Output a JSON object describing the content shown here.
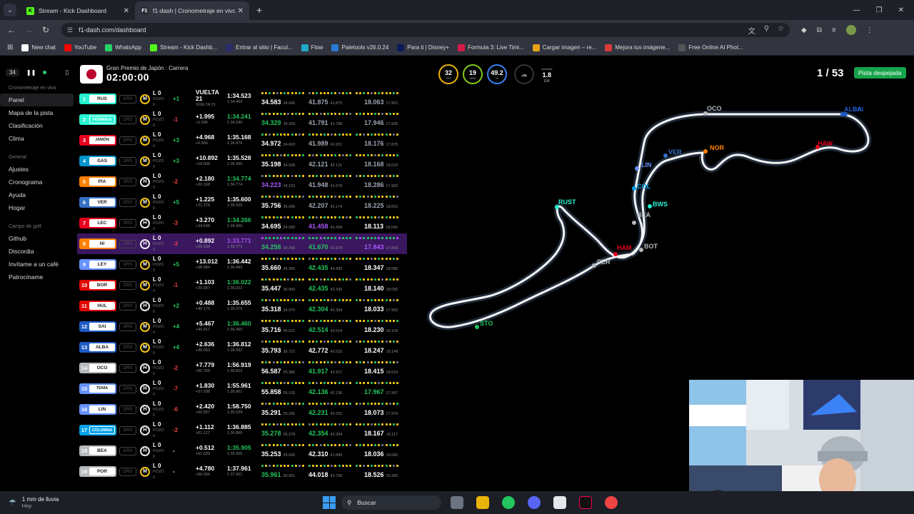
{
  "browser": {
    "tabs": [
      {
        "title": "Stream - Kick Dashboard",
        "fav": "K",
        "fav_color": "#53fc18",
        "active": false
      },
      {
        "title": "f1-dash | Cronometraje en vivo",
        "fav": "F1",
        "fav_color": "#e10600",
        "active": true
      }
    ],
    "url": "f1-dash.com/dashboard",
    "bookmarks": [
      {
        "label": "New chat",
        "color": "#ffffff"
      },
      {
        "label": "YouTube",
        "color": "#ff0000"
      },
      {
        "label": "WhatsApp",
        "color": "#25d366"
      },
      {
        "label": "Stream - Kick Dashb...",
        "color": "#53fc18"
      },
      {
        "label": "Entrar al sitio | Facul...",
        "color": "#2b2b6b"
      },
      {
        "label": "Flow",
        "color": "#22aacc"
      },
      {
        "label": "Paletools v26.0.24",
        "color": "#2a7ad4"
      },
      {
        "label": "Para ti | Disney+",
        "color": "#0a1a5a"
      },
      {
        "label": "Formula 3: Live Timi...",
        "color": "#d51a4a"
      },
      {
        "label": "Cargar imagen – re...",
        "color": "#e8a21a"
      },
      {
        "label": "Mejora tus imágene...",
        "color": "#d93a3a"
      },
      {
        "label": "Free Online AI Phot...",
        "color": "#555555"
      }
    ]
  },
  "sidebar": {
    "delay_badge": "34",
    "sections": [
      {
        "title": "Cronometraje en vivo",
        "items": [
          "Panel",
          "Mapa de la pista",
          "Clasificación",
          "Clima"
        ]
      },
      {
        "title": "General",
        "items": [
          "Ajustes",
          "Cronograma",
          "Ayuda",
          "Hogar"
        ]
      },
      {
        "title": "Campo de golf",
        "items": [
          "Github",
          "Discordia",
          "Invítame a un café",
          "Patrocíname"
        ]
      }
    ]
  },
  "header": {
    "race_name": "Gran Premio de Japón : Carrera",
    "race_clock": "02:00:00",
    "weather": [
      {
        "value": "32",
        "label": "TRC",
        "color": "#eab308"
      },
      {
        "value": "19",
        "label": "AIRE",
        "color": "#84cc16"
      },
      {
        "value": "49.2",
        "label": "%",
        "color": "#3b82f6"
      }
    ],
    "wind_value": "1.8",
    "wind_unit": "EM",
    "wind_dir": "noroeste",
    "lap": "1 / 53",
    "track_status": "Pista despejada",
    "track_status_color": "#16a34a"
  },
  "timing_rows": [
    {
      "pos": "1",
      "code": "RUS",
      "team": "#27f4d2",
      "tyre": "M",
      "gain": "+1",
      "gainc": "green",
      "gap": "VUELTA 21",
      "gapsub": "VUELTA 21",
      "lt": "1:34.523",
      "ltsub": "1:34.469",
      "ltc": "",
      "s1": "34.583",
      "s1s": "34.436",
      "s1c": "",
      "s2": "41.875",
      "s2s": "41.875",
      "s2c": "muted",
      "s3": "18.063",
      "s3s": "17.901",
      "s3c": "muted",
      "hl": false
    },
    {
      "pos": "2",
      "code": "HORMIGA",
      "team": "#27f4d2",
      "tyre": "M",
      "gain": "-1",
      "gainc": "red",
      "gap": "+1.995",
      "gapsub": "+1.995",
      "lt": "1:34.241",
      "ltsub": "1:34.095",
      "ltc": "green",
      "s1": "34.329",
      "s1s": "34.329",
      "s1c": "green",
      "s2": "41.791",
      "s2s": "41.758",
      "s2c": "muted",
      "s3": "17.946",
      "s3s": "17.836",
      "s3c": "muted",
      "hl": false
    },
    {
      "pos": "3",
      "code": "JAMÓN",
      "team": "#e80020",
      "tyre": "M",
      "gain": "+3",
      "gainc": "green",
      "gap": "+4.968",
      "gapsub": "+6.966",
      "lt": "1:35.168",
      "ltsub": "1:34.876",
      "ltc": "",
      "s1": "34.972",
      "s1s": "34.663",
      "s1c": "",
      "s2": "41.989",
      "s2s": "41.921",
      "s2c": "muted",
      "s3": "18.176",
      "s3s": "17.875",
      "s3c": "muted",
      "hl": false
    },
    {
      "pos": "4",
      "code": "GAS",
      "team": "#0093cc",
      "tyre": "M",
      "gain": "+3",
      "gainc": "green",
      "gap": "+10.892",
      "gapsub": "+18.008",
      "lt": "1:35.528",
      "ltsub": "1:35.436",
      "ltc": "",
      "s1": "35.198",
      "s1s": "34.939",
      "s1c": "",
      "s2": "42.121",
      "s2s": "42.121",
      "s2c": "muted",
      "s3": "18.168",
      "s3s": "18.023",
      "s3c": "muted",
      "hl": false
    },
    {
      "pos": "5",
      "code": "PIA",
      "team": "#ff8000",
      "tyre": "H",
      "gain": "-2",
      "gainc": "red",
      "gap": "+2.180",
      "gapsub": "+20.168",
      "lt": "1:34.774",
      "ltsub": "1:34.774",
      "ltc": "green",
      "s1": "34.223",
      "s1s": "34.223",
      "s1c": "purple",
      "s2": "41.948",
      "s2s": "41.678",
      "s2c": "muted",
      "s3": "18.286",
      "s3s": "17.982",
      "s3c": "muted",
      "hl": false
    },
    {
      "pos": "6",
      "code": "VER",
      "team": "#3671c6",
      "tyre": "M",
      "gain": "+5",
      "gainc": "green",
      "gap": "+1.225",
      "gapsub": "+21.378",
      "lt": "1:35.600",
      "ltsub": "1:35.535",
      "ltc": "",
      "s1": "35.756",
      "s1s": "35.066",
      "s1c": "",
      "s2": "42.207",
      "s2s": "42.174",
      "s2c": "muted",
      "s3": "18.225",
      "s3s": "18.001",
      "s3c": "muted",
      "hl": false
    },
    {
      "pos": "7",
      "code": "LEC",
      "team": "#e80020",
      "tyre": "H",
      "gain": "-3",
      "gainc": "red",
      "gap": "+3.270",
      "gapsub": "+24.648",
      "lt": "1:34.266",
      "ltsub": "1:34.266",
      "ltc": "green",
      "s1": "34.695",
      "s1s": "34.580",
      "s1c": "",
      "s2": "41.458",
      "s2s": "41.458",
      "s2c": "purple",
      "s3": "18.113",
      "s3s": "18.043",
      "s3c": "",
      "hl": false
    },
    {
      "pos": "8",
      "code": "NI",
      "team": "#ff8000",
      "tyre": "H",
      "gain": "-3",
      "gainc": "red",
      "gap": "+0.892",
      "gapsub": "+25.538",
      "lt": "1:33.771",
      "ltsub": "1:33.771",
      "ltc": "purple",
      "s1": "34.258",
      "s1s": "34.258",
      "s1c": "green",
      "s2": "41.670",
      "s2s": "41.670",
      "s2c": "green",
      "s3": "17.843",
      "s3s": "17.843",
      "s3c": "purple",
      "hl": true
    },
    {
      "pos": "9",
      "code": "LEY",
      "team": "#6692ff",
      "tyre": "M",
      "gain": "+5",
      "gainc": "green",
      "gap": "+13.012",
      "gapsub": "+38.584",
      "lt": "1:36.442",
      "ltsub": "1:36.442",
      "ltc": "",
      "s1": "35.660",
      "s1s": "35.306",
      "s1c": "",
      "s2": "42.435",
      "s2s": "42.435",
      "s2c": "green",
      "s3": "18.347",
      "s3s": "18.080",
      "s3c": "",
      "hl": false
    },
    {
      "pos": "10",
      "code": "BOR",
      "team": "#e10600",
      "tyre": "M",
      "gain": "-1",
      "gainc": "red",
      "gap": "+1.103",
      "gapsub": "+39.687",
      "lt": "1:36.022",
      "ltsub": "1:36.022",
      "ltc": "green",
      "s1": "35.447",
      "s1s": "35.083",
      "s1c": "",
      "s2": "42.435",
      "s2s": "42.435",
      "s2c": "green",
      "s3": "18.140",
      "s3s": "18.030",
      "s3c": "",
      "hl": false
    },
    {
      "pos": "11",
      "code": "HUL",
      "team": "#e10600",
      "tyre": "H",
      "gain": "+2",
      "gainc": "green",
      "gap": "+0.488",
      "gapsub": "+40.175",
      "lt": "1:35.655",
      "ltsub": "1:35.575",
      "ltc": "",
      "s1": "35.318",
      "s1s": "34.972",
      "s1c": "",
      "s2": "42.304",
      "s2s": "42.304",
      "s2c": "green",
      "s3": "18.033",
      "s3s": "17.962",
      "s3c": "",
      "hl": false
    },
    {
      "pos": "12",
      "code": "SAI",
      "team": "#1e5bc6",
      "tyre": "M",
      "gain": "+4",
      "gainc": "green",
      "gap": "+5.467",
      "gapsub": "+45.417",
      "lt": "1:36.460",
      "ltsub": "1:36.460",
      "ltc": "green",
      "s1": "35.716",
      "s1s": "35.621",
      "s1c": "",
      "s2": "42.514",
      "s2s": "42.514",
      "s2c": "green",
      "s3": "18.230",
      "s3s": "18.109",
      "s3c": "",
      "hl": false
    },
    {
      "pos": "13",
      "code": "ALBA",
      "team": "#1e5bc6",
      "tyre": "M",
      "gain": "+4",
      "gainc": "green",
      "gap": "+2.636",
      "gapsub": "+48.053",
      "lt": "1:36.812",
      "ltsub": "1:36.592",
      "ltc": "",
      "s1": "35.793",
      "s1s": "35.721",
      "s1c": "",
      "s2": "42.772",
      "s2s": "42.515",
      "s2c": "",
      "s3": "18.247",
      "s3s": "18.149",
      "s3c": "",
      "hl": false
    },
    {
      "pos": "14",
      "code": "OCO",
      "team": "#b6babd",
      "tyre": "H",
      "gain": "-2",
      "gainc": "red",
      "gap": "+7.779",
      "gapsub": "+55.768",
      "lt": "1:56.919",
      "ltsub": "1:36.822",
      "ltc": "",
      "s1": "56.587",
      "s1s": "35.386",
      "s1c": "",
      "s2": "41.917",
      "s2s": "41.917",
      "s2c": "green",
      "s3": "18.415",
      "s3s": "18.019",
      "s3c": "",
      "hl": false
    },
    {
      "pos": "15",
      "code": "TENÍA",
      "team": "#6692ff",
      "tyre": "H",
      "gain": "-7",
      "gainc": "red",
      "gap": "+1.830",
      "gapsub": "+57.598",
      "lt": "1:55.961",
      "ltsub": "1:35.961",
      "ltc": "",
      "s1": "55.858",
      "s1s": "35.105",
      "s1c": "",
      "s2": "42.136",
      "s2s": "42.136",
      "s2c": "green",
      "s3": "17.967",
      "s3s": "17.967",
      "s3c": "green",
      "hl": false
    },
    {
      "pos": "16",
      "code": "LIN",
      "team": "#6692ff",
      "tyre": "H",
      "gain": "-6",
      "gainc": "red",
      "gap": "+2.420",
      "gapsub": "+60.007",
      "lt": "1:58.750",
      "ltsub": "1:36.039",
      "ltc": "",
      "s1": "35.291",
      "s1s": "35.266",
      "s1c": "",
      "s2": "42.231",
      "s2s": "42.231",
      "s2c": "green",
      "s3": "18.073",
      "s3s": "17.979",
      "s3c": "",
      "hl": false
    },
    {
      "pos": "17",
      "code": "COLUMNA",
      "team": "#00a1e8",
      "tyre": "H",
      "gain": "-2",
      "gainc": "red",
      "gap": "+1.112",
      "gapsub": "+61.127",
      "lt": "1:36.885",
      "ltsub": "1:36.885",
      "ltc": "",
      "s1": "35.278",
      "s1s": "35.278",
      "s1c": "green",
      "s2": "42.354",
      "s2s": "42.354",
      "s2c": "green",
      "s3": "18.167",
      "s3s": "18.117",
      "s3c": "",
      "hl": false
    },
    {
      "pos": "18",
      "code": "BEA",
      "team": "#b6babd",
      "tyre": "H",
      "gain": "-",
      "gainc": "",
      "gap": "+0.512",
      "gapsub": "+61.639",
      "lt": "1:35.905",
      "ltsub": "1:35.905",
      "ltc": "green",
      "s1": "35.253",
      "s1s": "35.006",
      "s1c": "",
      "s2": "42.310",
      "s2s": "41.840",
      "s2c": "",
      "s3": "18.036",
      "s3s": "18.082",
      "s3c": "",
      "hl": false
    },
    {
      "pos": "19",
      "code": "POR",
      "team": "#b6babd",
      "tyre": "M",
      "gain": "-",
      "gainc": "",
      "gap": "+4.780",
      "gapsub": "+66.094",
      "lt": "1:37.961",
      "ltsub": "1:37.961",
      "ltc": "",
      "s1": "35.961",
      "s1s": "35.961",
      "s1c": "green",
      "s2": "44.018",
      "s2s": "42.756",
      "s2c": "",
      "s3": "18.526",
      "s3s": "18.360",
      "s3c": "",
      "hl": false
    }
  ],
  "row_labels": {
    "lap_prefix": "L 0",
    "pit_label": "POZO",
    "pit_count": "0",
    "drs": "DRS"
  },
  "track_cars": [
    {
      "code": "OCO",
      "color": "#b6babd"
    },
    {
      "code": "ALBA",
      "color": "#1e5bc6"
    },
    {
      "code": "SAI",
      "color": "#1e5bc6"
    },
    {
      "code": "NOR",
      "color": "#ff8000"
    },
    {
      "code": "HAW",
      "color": "#e80020"
    },
    {
      "code": "VER",
      "color": "#3671c6"
    },
    {
      "code": "LIN",
      "color": "#6692ff"
    },
    {
      "code": "COL",
      "color": "#00a1e8"
    },
    {
      "code": "BWS",
      "color": "#27f4d2"
    },
    {
      "code": "RUST",
      "color": "#27f4d2"
    },
    {
      "code": "BEA",
      "color": "#b6babd"
    },
    {
      "code": "HAM",
      "color": "#e80020"
    },
    {
      "code": "BOT",
      "color": "#b6babd"
    },
    {
      "code": "PER",
      "color": "#b6babd"
    },
    {
      "code": "STO",
      "color": "#22c55e"
    }
  ],
  "taskbar": {
    "weather_line1": "1 mm de lluvia",
    "weather_line2": "Hoy",
    "search_label": "Buscar"
  }
}
